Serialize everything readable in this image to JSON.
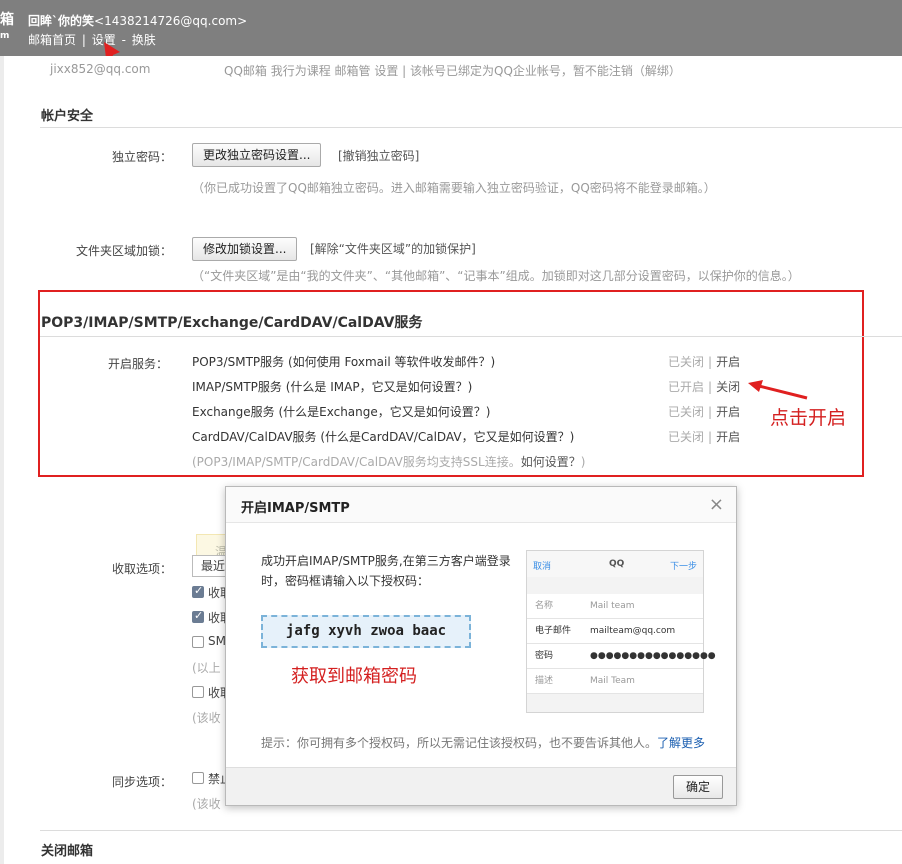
{
  "header": {
    "logo_fragment": "箱",
    "logo_small": "m",
    "account_name": "回眸`你的笑",
    "account_email": "<1438214726@qq.com>",
    "links": [
      "邮箱首页",
      "|",
      "设置",
      "-",
      "换肤"
    ]
  },
  "ghost_row": {
    "email": "jixx852@qq.com",
    "items": "QQ邮箱  我行为课程     邮箱管  设置 | 该帐号已绑定为QQ企业帐号，暂不能注销（解绑）"
  },
  "account_security": {
    "title": "帐户安全",
    "independent_password": {
      "label": "独立密码：",
      "button": "更改独立密码设置...",
      "cancel_link": "[撤销独立密码]",
      "hint": "（你已成功设置了QQ邮箱独立密码。进入邮箱需要输入独立密码验证，QQ密码将不能登录邮箱。）"
    },
    "folder_lock": {
      "label": "文件夹区域加锁：",
      "button": "修改加锁设置...",
      "cancel_link": "[解除“文件夹区域”的加锁保护]",
      "hint": "（“文件夹区域”是由“我的文件夹”、“其他邮箱”、“记事本”组成。加锁即对这几部分设置密码，以保护你的信息。）"
    }
  },
  "services": {
    "title": "POP3/IMAP/SMTP/Exchange/CardDAV/CalDAV服务",
    "label": "开启服务：",
    "rows": [
      {
        "name": "POP3/SMTP服务 (如何使用 Foxmail 等软件收发邮件？)",
        "state": "已关闭",
        "action": "开启"
      },
      {
        "name": "IMAP/SMTP服务 (什么是 IMAP，它又是如何设置？)",
        "state": "已开启",
        "action": "关闭"
      },
      {
        "name": "Exchange服务 (什么是Exchange，它又是如何设置？)",
        "state": "已关闭",
        "action": "开启"
      },
      {
        "name": "CardDAV/CalDAV服务 (什么是CardDAV/CalDAV，它又是如何设置？)",
        "state": "已关闭",
        "action": "开启"
      }
    ],
    "ssl_hint": "(POP3/IMAP/SMTP/CardDAV/CalDAV服务均支持SSL连接。",
    "ssl_link": "如何设置？",
    "ssl_hint_end": ")",
    "separator": "|"
  },
  "annotations": {
    "click_enable": "点击开启",
    "got_password": "获取到邮箱密码"
  },
  "background_form": {
    "notice_text": "温",
    "receive_label": "收取选项：",
    "receive_select": "最近",
    "receive_opts": [
      "收取",
      "收取",
      "SM",
      "(以上",
      "收取",
      "(该收"
    ],
    "sync_label": "同步选项：",
    "sync_opts": [
      "禁止",
      "(该收"
    ],
    "close_title": "关闭邮箱"
  },
  "modal": {
    "title": "开启IMAP/SMTP",
    "close": "×",
    "message": "成功开启IMAP/SMTP服务,在第三方客户端登录时，密码框请输入以下授权码：",
    "auth_code": "jafg xyvh zwoa baac",
    "note": "提示：你可拥有多个授权码，所以无需记住该授权码，也不要告诉其他人。",
    "note_link": "了解更多",
    "ok_button": "确定",
    "phone": {
      "cancel": "取消",
      "title": "QQ",
      "next": "下一步",
      "rows": [
        {
          "key": "名称",
          "value": "Mail team"
        },
        {
          "key": "电子邮件",
          "value": "mailteam@qq.com"
        },
        {
          "key": "密码",
          "value": "●●●●●●●●●●●●●●●●"
        },
        {
          "key": "描述",
          "value": "Mail Team"
        }
      ]
    }
  },
  "colors": {
    "highlight_red": "#e02020",
    "header_gray": "#7f7f7f",
    "link_blue": "#1a5eb0"
  }
}
